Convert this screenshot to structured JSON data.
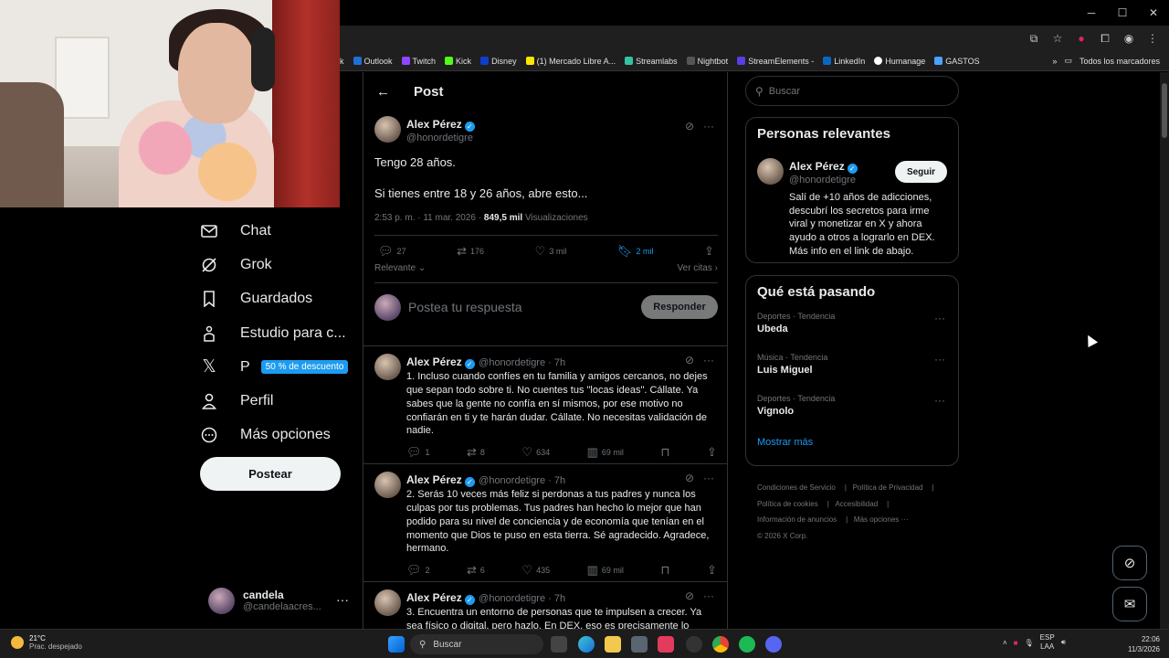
{
  "browser": {
    "window_controls": [
      "─",
      "☐",
      "✕"
    ],
    "bookmarks": [
      {
        "label": "k",
        "color": "#888888"
      },
      {
        "label": "Outlook",
        "color": "#1f6fd6"
      },
      {
        "label": "Twitch",
        "color": "#9146ff"
      },
      {
        "label": "Kick",
        "color": "#53fc18"
      },
      {
        "label": "Disney",
        "color": "#113ccf"
      },
      {
        "label": "(1) Mercado Libre A...",
        "color": "#ffe600"
      },
      {
        "label": "Streamlabs",
        "color": "#31c3a2"
      },
      {
        "label": "Nightbot",
        "color": "#555555"
      },
      {
        "label": "StreamElements -",
        "color": "#5b3de5"
      },
      {
        "label": "LinkedIn",
        "color": "#0a66c2"
      },
      {
        "label": "Humanage",
        "color": "#ffffff"
      },
      {
        "label": "GASTOS",
        "color": "#4aa3ff"
      }
    ],
    "bookmarks_more": "»",
    "all_bookmarks": "Todos los marcadores"
  },
  "nav": {
    "chat": "Chat",
    "grok": "Grok",
    "saved": "Guardados",
    "studio": "Estudio para c...",
    "premium": "P",
    "premium_promo": "50 % de descuento",
    "profile": "Perfil",
    "more": "Más opciones",
    "post_button": "Postear"
  },
  "account": {
    "name": "candela",
    "handle": "@candelaacres...",
    "more": "···"
  },
  "post": {
    "header_title": "Post",
    "author_name": "Alex Pérez",
    "author_handle": "@honordetigre",
    "line1": "Tengo 28 años.",
    "line2": "Si tienes entre 18 y 26 años, abre esto...",
    "time": "2:53 p. m. · 11 mar. 2026 ·",
    "views_count": "849,5 mil",
    "views_label": "Visualizaciones",
    "replies": "27",
    "reposts": "176",
    "likes": "3 mil",
    "bookmarks": "2 mil",
    "sort_label": "Relevante",
    "quotes_label": "Ver citas",
    "reply_placeholder": "Postea tu respuesta",
    "reply_button": "Responder"
  },
  "replies": [
    {
      "name": "Alex Pérez",
      "handle": "@honordetigre · 7h",
      "text": "1. Incluso cuando confíes en tu familia y amigos cercanos, no dejes que sepan todo sobre ti. No cuentes tus \"locas ideas\". Cállate. Ya sabes que la gente no confía en sí mismos, por ese motivo no confiarán en ti y te harán dudar. Cállate. No necesitas validación de nadie.",
      "replies": "1",
      "reposts": "8",
      "likes": "634",
      "views": "69 mil"
    },
    {
      "name": "Alex Pérez",
      "handle": "@honordetigre · 7h",
      "text": "2. Serás 10 veces más feliz si perdonas a tus padres y nunca los culpas por tus problemas. Tus padres han hecho lo mejor que han podido para su nivel de conciencia y de economía que tenían en el momento que Dios te puso en esta tierra. Sé agradecido. Agradece, hermano.",
      "replies": "2",
      "reposts": "6",
      "likes": "435",
      "views": "69 mil"
    },
    {
      "name": "Alex Pérez",
      "handle": "@honordetigre · 7h",
      "text": "3. Encuentra un entorno de personas que te impulsen a crecer. Ya sea físico o digital, pero hazlo. En DEX, eso es precisamente lo",
      "replies": "",
      "reposts": "",
      "likes": "",
      "views": ""
    }
  ],
  "sidebar": {
    "search_placeholder": "Buscar",
    "relevant_title": "Personas relevantes",
    "person_name": "Alex Pérez",
    "person_handle": "@honordetigre",
    "follow_button": "Seguir",
    "person_bio": "Salí de +10 años de adicciones, descubrí los secretos para irme viral y monetizar en X y ahora ayudo a otros a lograrlo en DEX. Más info en el link de abajo.",
    "trending_title": "Qué está pasando",
    "trends": [
      {
        "category": "Deportes · Tendencia",
        "name": "Ubeda"
      },
      {
        "category": "Música · Tendencia",
        "name": "Luis Miguel"
      },
      {
        "category": "Deportes · Tendencia",
        "name": "Vignolo"
      }
    ],
    "show_more": "Mostrar más",
    "footer_links": [
      "Condiciones de Servicio",
      "Política de Privacidad",
      "Política de cookies",
      "Accesibilidad",
      "Información de anuncios",
      "Más opciones ···"
    ],
    "copyright": "© 2026 X Corp."
  },
  "taskbar": {
    "temperature": "21°C",
    "weather": "Prac. despejado",
    "search": "Buscar",
    "lang1": "ESP",
    "lang2": "LAA",
    "time": "22:06",
    "date": "11/3/2026"
  }
}
